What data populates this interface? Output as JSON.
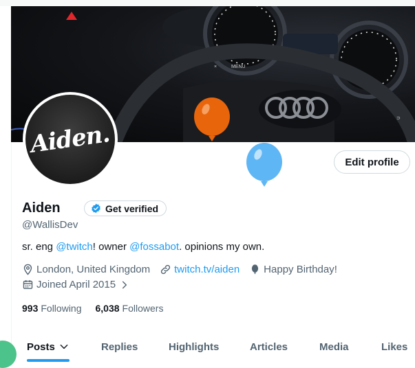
{
  "profile": {
    "display_name": "Aiden",
    "verify_label": "Get verified",
    "handle": "@WallisDev",
    "avatar_text": "Aiden.",
    "edit_label": "Edit profile",
    "bio": {
      "prefix": "sr. eng ",
      "mention1": "@twitch",
      "middle": "! owner ",
      "mention2": "@fossabot",
      "suffix": ". opinions my own."
    },
    "location": "London, United Kingdom",
    "website": "twitch.tv/aiden",
    "birthday": "Happy Birthday!",
    "joined": "Joined April 2015",
    "following_count": "993",
    "following_label": "Following",
    "followers_count": "6,038",
    "followers_label": "Followers"
  },
  "tabs": [
    {
      "label": "Posts"
    },
    {
      "label": "Replies"
    },
    {
      "label": "Highlights"
    },
    {
      "label": "Articles"
    },
    {
      "label": "Media"
    },
    {
      "label": "Likes"
    }
  ],
  "colors": {
    "accent": "#1d9bf0",
    "balloon_orange": "#e8650c",
    "balloon_blue": "#5fb6f5"
  },
  "icons": [
    "location-icon",
    "link-icon",
    "balloon-icon",
    "calendar-icon",
    "chevron-right-icon",
    "chevron-down-icon",
    "verified-badge-icon"
  ]
}
